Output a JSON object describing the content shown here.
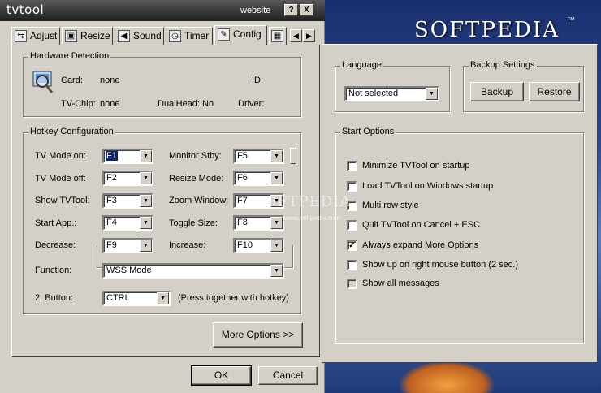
{
  "window": {
    "title": "tvtool",
    "website_label": "website",
    "help_label": "?",
    "close_label": "X"
  },
  "tabs": [
    {
      "label": "Adjust",
      "icon": "adjust-icon",
      "glyph": "⇆"
    },
    {
      "label": "Resize",
      "icon": "resize-icon",
      "glyph": "▣"
    },
    {
      "label": "Sound",
      "icon": "sound-icon",
      "glyph": "◀"
    },
    {
      "label": "Timer",
      "icon": "timer-icon",
      "glyph": "◷"
    },
    {
      "label": "Config",
      "icon": "config-icon",
      "glyph": "✎"
    }
  ],
  "tab_scroll": {
    "left": "◀",
    "right": "▶"
  },
  "hardware": {
    "legend": "Hardware Detection",
    "card_label": "Card:",
    "card_value": "none",
    "id_label": "ID:",
    "tvchip_label": "TV-Chip:",
    "tvchip_value": "none",
    "dualhead_label": "DualHead:",
    "dualhead_value": "No",
    "driver_label": "Driver:"
  },
  "hotkeys": {
    "legend": "Hotkey Configuration",
    "rows": [
      {
        "left_label": "TV Mode on:",
        "left_value": "F1",
        "right_label": "Monitor Stby:",
        "right_value": "F5"
      },
      {
        "left_label": "TV Mode off:",
        "left_value": "F2",
        "right_label": "Resize Mode:",
        "right_value": "F6"
      },
      {
        "left_label": "Show TVTool:",
        "left_value": "F3",
        "right_label": "Zoom Window:",
        "right_value": "F7"
      },
      {
        "left_label": "Start App.:",
        "left_value": "F4",
        "right_label": "Toggle Size:",
        "right_value": "F8"
      },
      {
        "left_label": "Decrease:",
        "left_value": "F9",
        "right_label": "Increase:",
        "right_value": "F10"
      }
    ],
    "function_label": "Function:",
    "function_value": "WSS Mode",
    "button2_label": "2. Button:",
    "button2_value": "CTRL",
    "button2_hint": "(Press together with hotkey)"
  },
  "buttons": {
    "more_options": "More Options >>",
    "ok": "OK",
    "cancel": "Cancel"
  },
  "options": {
    "language_legend": "Language",
    "language_value": "Not selected",
    "backup_legend": "Backup Settings",
    "backup_button": "Backup",
    "restore_button": "Restore",
    "start_legend": "Start Options",
    "checkboxes": [
      {
        "label": "Minimize TVTool on startup",
        "checked": false
      },
      {
        "label": "Load TVTool on Windows startup",
        "checked": false
      },
      {
        "label": "Multi row style",
        "checked": false
      },
      {
        "label": "Quit TVTool on Cancel + ESC",
        "checked": false
      },
      {
        "label": "Always expand More Options",
        "checked": true
      },
      {
        "label": "Show up on right mouse button (2 sec.)",
        "checked": false
      },
      {
        "label": "Show all messages",
        "checked": false
      }
    ]
  },
  "background": {
    "brand": "SOFTPEDIA",
    "trademark": "™",
    "watermark": "SOFTPEDIA",
    "watermark_url": "www.softpedia.com"
  }
}
